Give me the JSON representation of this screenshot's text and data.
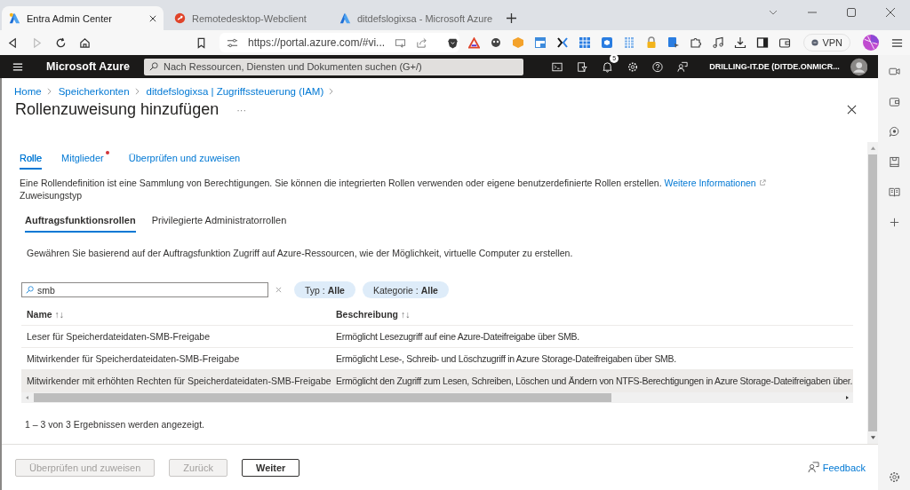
{
  "browser": {
    "tabs": [
      {
        "title": "Entra Admin Center",
        "selected": true,
        "kind": "entra"
      },
      {
        "title": "Remotedesktop-Webclient",
        "selected": false,
        "kind": "remote"
      },
      {
        "title": "ditdefslogixsa - Microsoft Azure",
        "selected": false,
        "kind": "azure"
      }
    ],
    "address": "https://portal.azure.com/#vi...",
    "vpn_label": "VPN"
  },
  "portal": {
    "brand": "Microsoft Azure",
    "search_placeholder": "Nach Ressourcen, Diensten und Dokumenten suchen (G+/)",
    "notification_count": "5",
    "tenant": "DRILLING-IT.DE (DITDE.ONMICR..."
  },
  "breadcrumb": [
    "Home",
    "Speicherkonten",
    "ditdefslogixsa | Zugriffssteuerung (IAM)"
  ],
  "page": {
    "title": "Rollenzuweisung hinzufügen",
    "more": "···"
  },
  "wizard_tabs": [
    {
      "label": "Rolle",
      "selected": true,
      "required": false
    },
    {
      "label": "Mitglieder",
      "selected": false,
      "required": true
    },
    {
      "label": "Überprüfen und zuweisen",
      "selected": false,
      "required": false
    }
  ],
  "description": {
    "text": "Eine Rollendefinition ist eine Sammlung von Berechtigungen. Sie können die integrierten Rollen verwenden oder eigene benutzerdefinierte Rollen erstellen.",
    "link": "Weitere Informationen"
  },
  "assignment_type_label": "Zuweisungstyp",
  "role_tabs": [
    {
      "label": "Auftragsfunktionsrollen",
      "selected": true
    },
    {
      "label": "Privilegierte Administratorrollen",
      "selected": false
    }
  ],
  "role_tab_description": "Gewähren Sie basierend auf der Auftragsfunktion Zugriff auf Azure-Ressourcen, wie der Möglichkeit, virtuelle Computer zu erstellen.",
  "search": {
    "value": "smb"
  },
  "filters": [
    "Typ : **Alle**",
    "Kategorie : **Alle**"
  ],
  "table": {
    "columns": [
      {
        "label": "Name",
        "sort": "↑↓"
      },
      {
        "label": "Beschreibung",
        "sort": "↑↓"
      }
    ],
    "rows": [
      {
        "name": "Leser für Speicherdateidaten-SMB-Freigabe",
        "description": "Ermöglicht Lesezugriff auf eine Azure-Dateifreigabe über SMB.",
        "selected": false
      },
      {
        "name": "Mitwirkender für Speicherdateidaten-SMB-Freigabe",
        "description": "Ermöglicht Lese-, Schreib- und Löschzugriff in Azure Storage-Dateifreigaben über SMB.",
        "selected": false
      },
      {
        "name": "Mitwirkender mit erhöhten Rechten für Speicherdateidaten-SMB-Freigabe",
        "description": "Ermöglicht den Zugriff zum Lesen, Schreiben, Löschen und Ändern von NTFS-Berechtigungen in Azure Storage-Dateifreigaben über.",
        "selected": true
      }
    ]
  },
  "result_count": "1 – 3 von 3 Ergebnissen werden angezeigt.",
  "footer": {
    "buttons": [
      {
        "label": "Überprüfen und zuweisen",
        "disabled": true
      },
      {
        "label": "Zurück",
        "disabled": true
      },
      {
        "label": "Weiter",
        "disabled": false
      }
    ],
    "feedback": "Feedback"
  }
}
